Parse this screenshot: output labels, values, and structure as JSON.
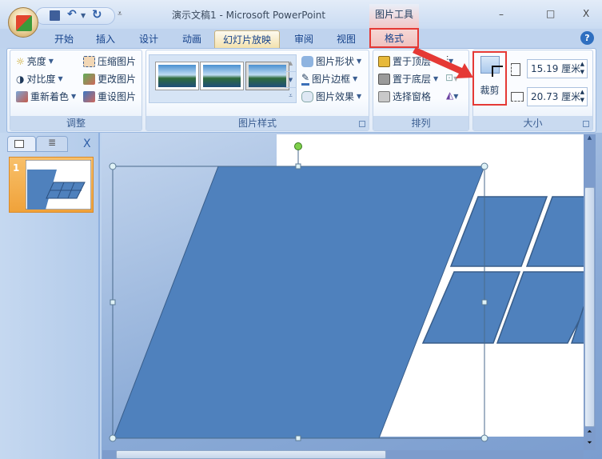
{
  "window": {
    "title": "演示文稿1 - Microsoft PowerPoint",
    "context_tool": "图片工具",
    "minimize": "–",
    "maximize": "□",
    "close": "X",
    "help": "?"
  },
  "tabs": [
    "开始",
    "插入",
    "设计",
    "动画",
    "幻灯片放映",
    "审阅",
    "视图",
    "格式"
  ],
  "ribbon": {
    "adjust": {
      "label": "调整",
      "brightness": "亮度",
      "contrast": "对比度",
      "recolor": "重新着色",
      "compress": "压缩图片",
      "change": "更改图片",
      "reset": "重设图片"
    },
    "styles": {
      "label": "图片样式",
      "shape": "图片形状",
      "border": "图片边框",
      "effects": "图片效果"
    },
    "arrange": {
      "label": "排列",
      "front": "置于顶层",
      "back": "置于底层",
      "pane": "选择窗格"
    },
    "size": {
      "label": "大小",
      "crop": "裁剪",
      "height": "15.19 厘米",
      "width": "20.73 厘米"
    }
  },
  "slides_pane": {
    "slide_number": "1",
    "close": "X"
  },
  "colors": {
    "shape": "#4f81bd",
    "highlight": "#e53935",
    "accent_orange": "#f5a742"
  }
}
